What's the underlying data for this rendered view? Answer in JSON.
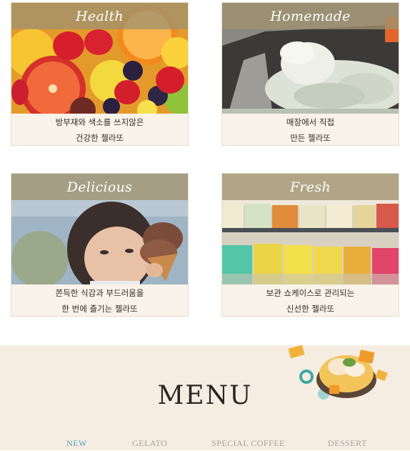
{
  "features": [
    {
      "title": "Health",
      "caption_line1": "방부재와 색소를 쓰지않은",
      "caption_line2": "건강한 젤라또",
      "photo": "citrus-fruits-photo"
    },
    {
      "title": "Homemade",
      "caption_line1": "매장에서 직접",
      "caption_line2": "만든 젤라또",
      "photo": "gelato-scoop-photo"
    },
    {
      "title": "Delicious",
      "caption_line1": "쫀득한 식감과 부드러움을",
      "caption_line2": "한 번에 즐기는 젤라또",
      "photo": "child-eating-gelato-photo"
    },
    {
      "title": "Fresh",
      "caption_line1": "보관 쇼케이스로 관리되는",
      "caption_line2": "신선한 젤라또",
      "photo": "gelato-showcase-photo"
    }
  ],
  "menu": {
    "title": "MENU",
    "tabs": [
      {
        "label": "NEW",
        "active": true
      },
      {
        "label": "GELATO",
        "active": false
      },
      {
        "label": "SPECIAL COFFEE",
        "active": false
      },
      {
        "label": "DESSERT",
        "active": false
      }
    ]
  },
  "colors": {
    "banner_overlay": "#a0926e",
    "card_caption_bg": "#faf3ea",
    "menu_bg": "#f6ede2",
    "active_tab": "#4fa2b0",
    "inactive_tab": "#a59f98"
  }
}
